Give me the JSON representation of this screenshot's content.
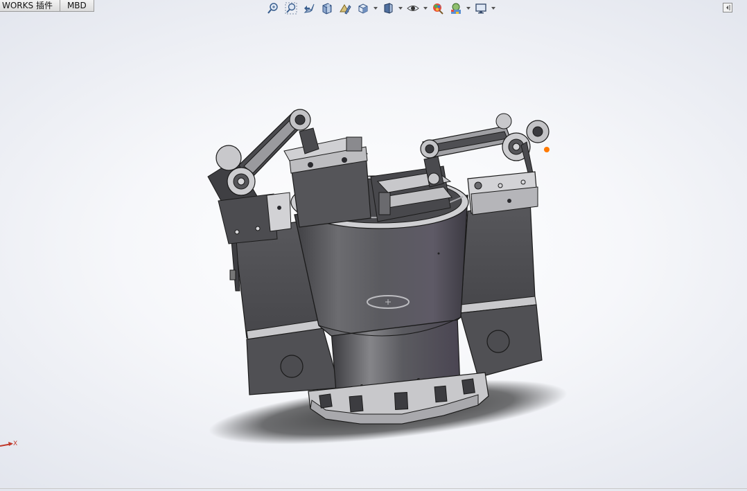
{
  "app": {
    "tabs": [
      {
        "label": "WORKS 插件"
      },
      {
        "label": "MBD"
      }
    ]
  },
  "heads_up_toolbar": {
    "buttons": [
      {
        "icon": "zoom-to-fit-icon"
      },
      {
        "icon": "zoom-to-area-icon"
      },
      {
        "icon": "previous-view-icon"
      },
      {
        "icon": "section-view-icon"
      },
      {
        "icon": "dynamic-annotation-icon"
      },
      {
        "icon": "view-orientation-icon"
      },
      {
        "icon": "display-style-icon"
      },
      {
        "icon": "hide-show-items-icon"
      },
      {
        "icon": "edit-appearance-icon"
      },
      {
        "icon": "apply-scene-icon"
      },
      {
        "icon": "view-settings-icon"
      }
    ]
  },
  "triad": {
    "x_label": "X",
    "x_color": "#c0392b"
  },
  "colors": {
    "part_body": "#5a5a5e",
    "part_highlight": "#b9b9bd",
    "part_edge": "#1a1a1a",
    "selection_dot": "#ff7a00"
  }
}
